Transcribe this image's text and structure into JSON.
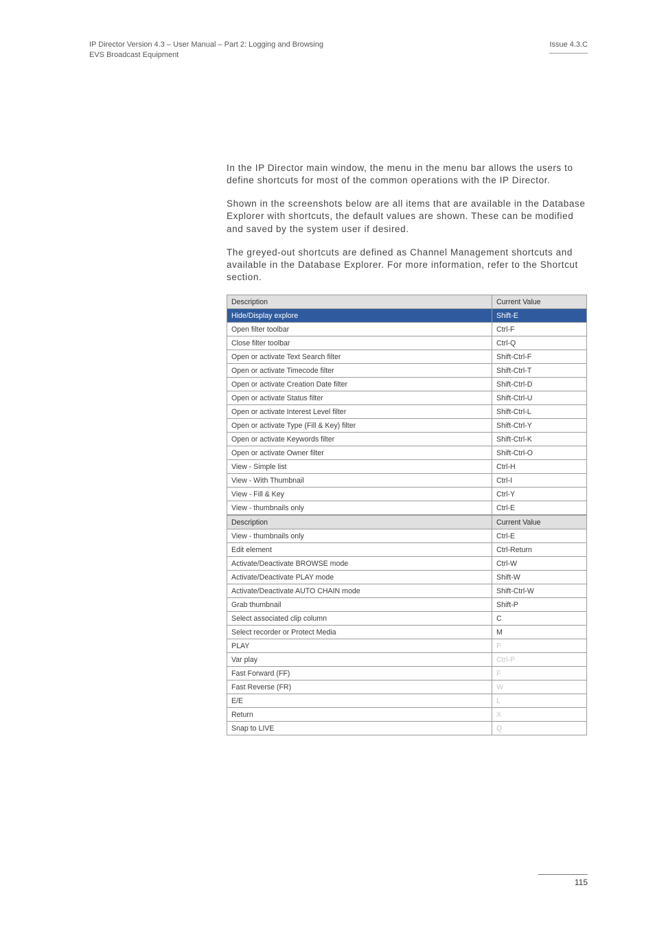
{
  "header": {
    "left_line1": "IP Director Version 4.3 – User Manual – Part 2: Logging and Browsing",
    "left_line2": "EVS Broadcast Equipment",
    "right": "Issue 4.3.C"
  },
  "paragraphs": {
    "p1_a": "In the IP Director main window, the menu",
    "p1_b": " in the menu bar allows the users to define shortcuts for most of the common operations with the IP Director.",
    "p2": "Shown in the screenshots below are all items that are available in the Database Explorer with shortcuts, the default values are shown. These can be modified and saved by the system user if desired.",
    "p3": "The greyed-out shortcuts are defined as Channel Management shortcuts and available in the Database Explorer. For more information, refer to the Shortcut section."
  },
  "table1": {
    "header": {
      "desc": "Description",
      "val": "Current Value"
    },
    "rows": [
      {
        "desc": "Hide/Display explore",
        "val": "Shift-E",
        "selected": true
      },
      {
        "desc": "Open filter toolbar",
        "val": "Ctrl-F"
      },
      {
        "desc": "Close filter toolbar",
        "val": "Ctrl-Q"
      },
      {
        "desc": "Open or activate Text Search filter",
        "val": "Shift-Ctrl-F"
      },
      {
        "desc": "Open or activate Timecode filter",
        "val": "Shift-Ctrl-T"
      },
      {
        "desc": "Open or activate Creation Date filter",
        "val": "Shift-Ctrl-D"
      },
      {
        "desc": "Open or activate Status filter",
        "val": "Shift-Ctrl-U"
      },
      {
        "desc": "Open or activate Interest Level filter",
        "val": "Shift-Ctrl-L"
      },
      {
        "desc": "Open or activate Type (Fill & Key) filter",
        "val": "Shift-Ctrl-Y"
      },
      {
        "desc": "Open or activate Keywords filter",
        "val": "Shift-Ctrl-K"
      },
      {
        "desc": "Open or activate Owner filter",
        "val": "Shift-Ctrl-O"
      },
      {
        "desc": "View - Simple list",
        "val": "Ctrl-H"
      },
      {
        "desc": "View - With Thumbnail",
        "val": "Ctrl-I"
      },
      {
        "desc": "View - Fill & Key",
        "val": "Ctrl-Y"
      },
      {
        "desc": "View - thumbnails only",
        "val": "Ctrl-E"
      }
    ]
  },
  "table2": {
    "header": {
      "desc": "Description",
      "val": "Current Value"
    },
    "rows": [
      {
        "desc": "View - thumbnails only",
        "val": "Ctrl-E"
      },
      {
        "desc": "Edit element",
        "val": "Ctrl-Return"
      },
      {
        "desc": "Activate/Deactivate BROWSE mode",
        "val": "Ctrl-W"
      },
      {
        "desc": "Activate/Deactivate PLAY mode",
        "val": "Shift-W"
      },
      {
        "desc": "Activate/Deactivate AUTO CHAIN mode",
        "val": "Shift-Ctrl-W"
      },
      {
        "desc": "Grab thumbnail",
        "val": "Shift-P"
      },
      {
        "desc": "Select associated clip column",
        "val": "C"
      },
      {
        "desc": "Select recorder or Protect Media",
        "val": "M"
      },
      {
        "desc": "PLAY",
        "val": "P",
        "disabled": true
      },
      {
        "desc": "Var play",
        "val": "Ctrl-P",
        "disabled": true
      },
      {
        "desc": "Fast Forward (FF)",
        "val": "F",
        "disabled": true
      },
      {
        "desc": "Fast Reverse (FR)",
        "val": "W",
        "disabled": true
      },
      {
        "desc": "E/E",
        "val": "L",
        "disabled": true
      },
      {
        "desc": "Return",
        "val": "X",
        "disabled": true
      },
      {
        "desc": "Snap to LIVE",
        "val": "Q",
        "disabled": true
      }
    ]
  },
  "footer": {
    "page": "115"
  }
}
